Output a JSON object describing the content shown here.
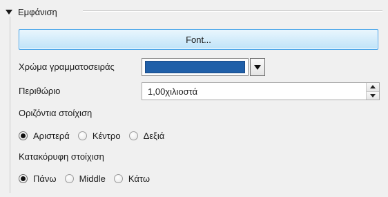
{
  "section": {
    "title": "Εμφάνιση",
    "expanded": true
  },
  "font_button": {
    "label": "Font..."
  },
  "font_color": {
    "label": "Χρώμα γραμματοσειράς",
    "value": "#1f5fa8"
  },
  "margin": {
    "label": "Περιθώριο",
    "value": "1,00χιλιοστά"
  },
  "horizontal_alignment": {
    "label": "Οριζόντια στοίχιση",
    "options": [
      {
        "label": "Αριστερά",
        "checked": true
      },
      {
        "label": "Κέντρο",
        "checked": false
      },
      {
        "label": "Δεξιά",
        "checked": false
      }
    ]
  },
  "vertical_alignment": {
    "label": "Κατακόρυφη στοίχιση",
    "options": [
      {
        "label": "Πάνω",
        "checked": true
      },
      {
        "label": "Middle",
        "checked": false
      },
      {
        "label": "Κάτω",
        "checked": false
      }
    ]
  },
  "colors": {
    "panel_bg": "#f0f0f0",
    "button_border": "#3c9ee7",
    "swatch": "#1f5fa8"
  },
  "icons": {
    "collapse": "chevron-down-icon",
    "dropdown": "triangle-down-icon",
    "spin_up": "arrow-up-icon",
    "spin_down": "arrow-down-icon"
  }
}
